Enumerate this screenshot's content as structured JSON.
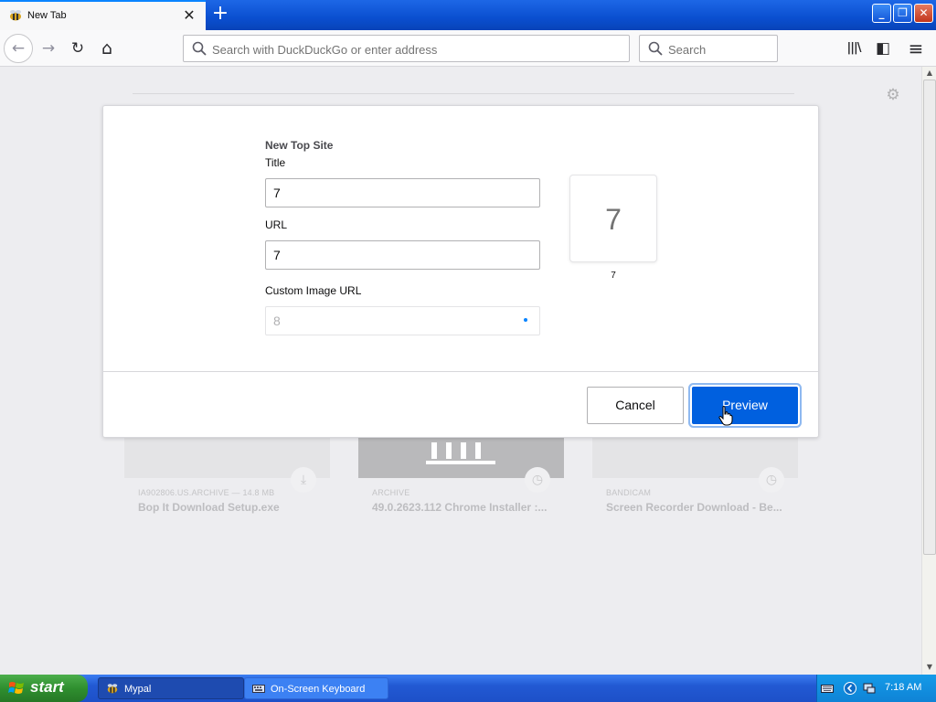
{
  "browser": {
    "tab": {
      "title": "New Tab",
      "close_glyph": "✕",
      "favicon": "bee-icon"
    },
    "new_tab_glyph": "+",
    "window_buttons": {
      "minimize": "_",
      "restore": "❐",
      "close": "✕"
    },
    "nav": {
      "back": "←",
      "forward": "→",
      "reload": "↻",
      "home": "⌂",
      "url_placeholder": "Search with DuckDuckGo or enter address",
      "search_placeholder": "Search",
      "library": "|||\\",
      "sidebar": "◧",
      "menu": "≡"
    }
  },
  "new_tab_page": {
    "settings_glyph": "⚙",
    "cards": [
      {
        "source": "IA902806.US.ARCHIVE — 14.8 MB",
        "title": "Bop It Download Setup.exe",
        "badge": "download-icon",
        "badge_glyph": "⤓"
      },
      {
        "source": "ARCHIVE",
        "title": "49.0.2623.112 Chrome Installer :...",
        "badge": "clock-icon",
        "badge_glyph": "◷"
      },
      {
        "source": "BANDICAM",
        "title": "Screen Recorder Download - Be...",
        "badge": "clock-icon",
        "badge_glyph": "◷"
      }
    ]
  },
  "dialog": {
    "heading": "New Top Site",
    "title_label": "Title",
    "title_value": "7",
    "url_label": "URL",
    "url_value": "7",
    "custom_image_label": "Custom Image URL",
    "custom_image_value": "8",
    "preview_tile_text": "7",
    "preview_caption": "7",
    "cancel_label": "Cancel",
    "preview_label": "Preview"
  },
  "taskbar": {
    "start_label": "start",
    "tasks": [
      {
        "label": "Mypal",
        "active": true
      },
      {
        "label": "On-Screen Keyboard",
        "active": false
      }
    ],
    "clock": "7:18 AM"
  },
  "colors": {
    "accent_blue": "#0060df",
    "focus_ring": "#0a84ff",
    "xp_taskbar": "#245edb",
    "xp_start_green": "#3c9a3c"
  }
}
